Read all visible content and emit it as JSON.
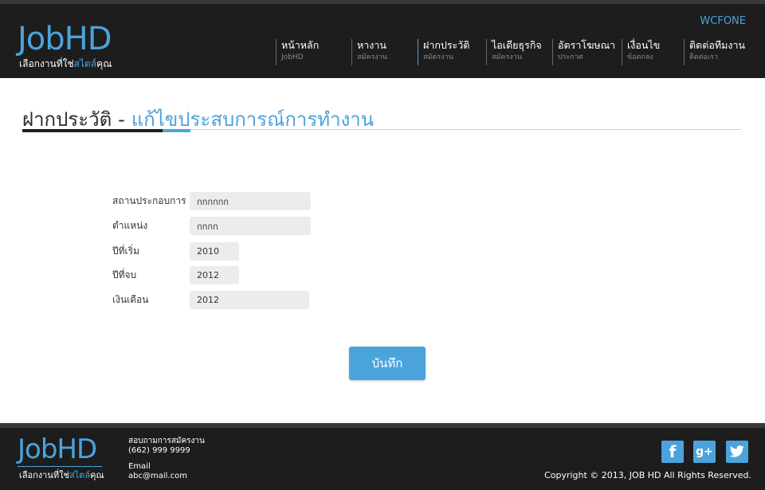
{
  "header": {
    "logo": "JobHD",
    "tagline_main": "เลือกงานที่ใช่",
    "tagline_accent": "สไตล์",
    "tagline_end": "คุณ",
    "user_name": "WCFONE",
    "nav": [
      {
        "title": "หน้าหลัก",
        "sub": "JobHD"
      },
      {
        "title": "หางาน",
        "sub": "สมัครงาน"
      },
      {
        "title": "ฝากประวัติ",
        "sub": "สมัครงาน"
      },
      {
        "title": "ไอเดียธุรกิจ",
        "sub": "สมัครงาน"
      },
      {
        "title": "อัตราโฆษณา",
        "sub": "ประกาศ"
      },
      {
        "title": "เงื่อนไข",
        "sub": "ข้อตกลง"
      },
      {
        "title": "ติดต่อทีมงาน",
        "sub": "ติดต่อเรา"
      }
    ]
  },
  "page": {
    "title": "ฝากประวัติ",
    "separator": "-",
    "subtitle": "แก้ไขประสบการณ์การทำงาน"
  },
  "form": {
    "fields": [
      {
        "label": "สถานประกอบการ",
        "value": "กกกกกก"
      },
      {
        "label": "ตำแหน่ง",
        "value": "กกกก"
      },
      {
        "label": "ปีที่เริ่ม",
        "value": "2010"
      },
      {
        "label": "ปีที่จบ",
        "value": "2012"
      },
      {
        "label": "เงินเดือน",
        "value": "2012"
      }
    ],
    "save_label": "บันทึก"
  },
  "footer": {
    "logo": "JobHD",
    "tagline_main": "เลือกงานที่ใช่",
    "tagline_accent": "สไตล์",
    "tagline_end": "คุณ",
    "contact_title": "สอบถามการสมัครงาน",
    "phone": "(662) 999 9999",
    "email_label": "Email",
    "email": "abc@mail.com",
    "copyright": "Copyright © 2013, JOB HD All Rights Reserved.",
    "social": [
      {
        "icon": "facebook-icon",
        "glyph": "f"
      },
      {
        "icon": "google-plus-icon",
        "glyph": "g+"
      },
      {
        "icon": "twitter-icon",
        "glyph": "t"
      }
    ]
  },
  "colors": {
    "accent": "#4ba3dc",
    "header_bg": "#1d1d1d",
    "input_bg": "#ececec"
  }
}
